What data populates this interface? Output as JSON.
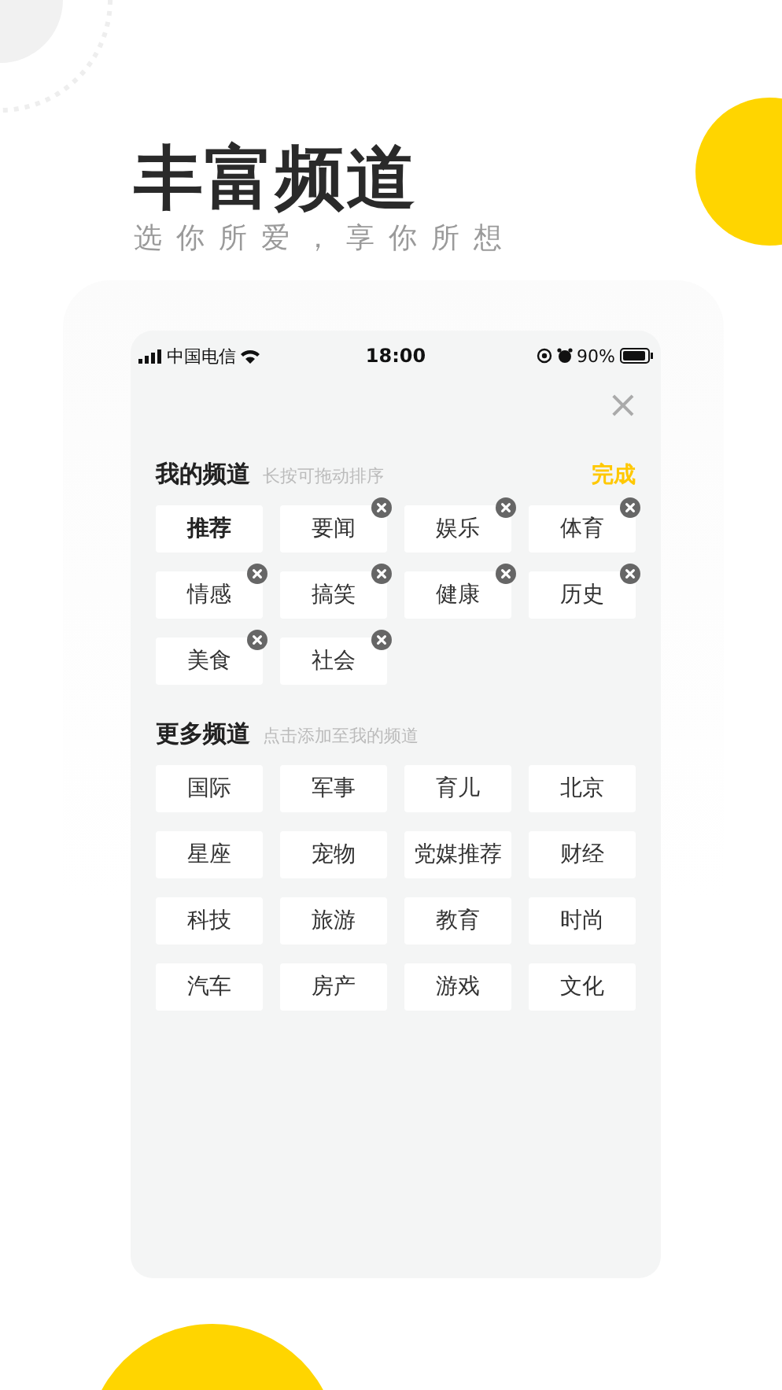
{
  "headline": "丰富频道",
  "tagline": "选你所爱，享你所想",
  "status_bar": {
    "carrier": "中国电信",
    "time": "18:00",
    "battery": "90%"
  },
  "close_icon": "×",
  "my_channels": {
    "title": "我的频道",
    "hint": "长按可拖动排序",
    "action": "完成",
    "items": [
      {
        "label": "推荐",
        "removable": false
      },
      {
        "label": "要闻",
        "removable": true
      },
      {
        "label": "娱乐",
        "removable": true
      },
      {
        "label": "体育",
        "removable": true
      },
      {
        "label": "情感",
        "removable": true
      },
      {
        "label": "搞笑",
        "removable": true
      },
      {
        "label": "健康",
        "removable": true
      },
      {
        "label": "历史",
        "removable": true
      },
      {
        "label": "美食",
        "removable": true
      },
      {
        "label": "社会",
        "removable": true
      }
    ]
  },
  "more_channels": {
    "title": "更多频道",
    "hint": "点击添加至我的频道",
    "items": [
      "国际",
      "军事",
      "育儿",
      "北京",
      "星座",
      "宠物",
      "党媒推荐",
      "财经",
      "科技",
      "旅游",
      "教育",
      "时尚",
      "汽车",
      "房产",
      "游戏",
      "文化"
    ]
  }
}
